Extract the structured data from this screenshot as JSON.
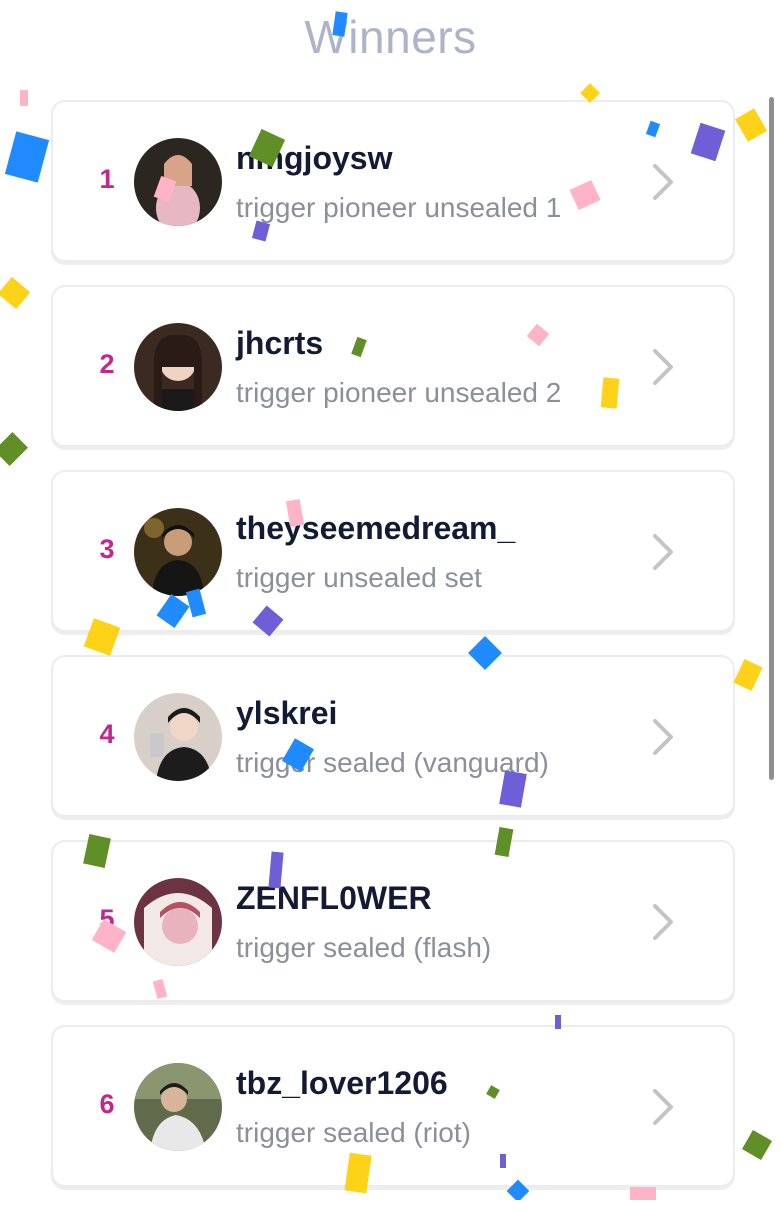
{
  "page": {
    "title": "Winners"
  },
  "winners": [
    {
      "rank": "1",
      "username": "nmgjoysw",
      "prize": "trigger pioneer unsealed 1",
      "avatar_colors": [
        "#2b2620",
        "#e8b7c4"
      ]
    },
    {
      "rank": "2",
      "username": "jhcrts",
      "prize": "trigger pioneer unsealed 2",
      "avatar_colors": [
        "#3a2a22",
        "#f1d3c4"
      ]
    },
    {
      "rank": "3",
      "username": "theyseemedream_",
      "prize": "trigger unsealed set",
      "avatar_colors": [
        "#3c3018",
        "#151515"
      ]
    },
    {
      "rank": "4",
      "username": "ylskrei",
      "prize": "trigger sealed (vanguard)",
      "avatar_colors": [
        "#d9cfc9",
        "#1c1c1c"
      ]
    },
    {
      "rank": "5",
      "username": "ZENFL0WER",
      "prize": "trigger sealed (flash)",
      "avatar_colors": [
        "#6b3440",
        "#e9b3bd"
      ]
    },
    {
      "rank": "6",
      "username": "tbz_lover1206",
      "prize": "trigger sealed (riot)",
      "avatar_colors": [
        "#5f6b4a",
        "#e8e8e8"
      ]
    }
  ],
  "colors": {
    "rank": "#c2268f",
    "title": "#aeb4c8",
    "confetti": [
      "#1f8bff",
      "#ffd21a",
      "#6f5fd6",
      "#5f8f26",
      "#ffb3c6"
    ]
  },
  "icons": {
    "row_action": "chevron-right-icon"
  }
}
